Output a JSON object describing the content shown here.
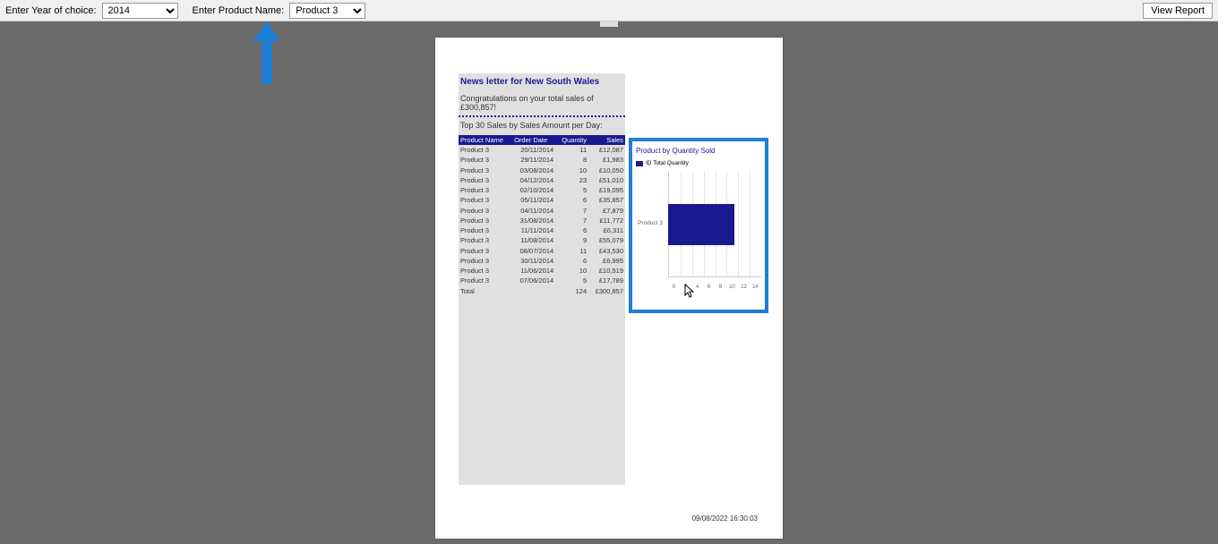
{
  "params": {
    "year_label": "Enter Year of choice:",
    "year_value": "2014",
    "product_label": "Enter Product Name:",
    "product_value": "Product 3",
    "view_report": "View Report"
  },
  "report": {
    "newsletter_title": "News letter for New South Wales",
    "congrats": "Congratulations on your total sales of £300,857!",
    "top_sales_title": "Top 30 Sales by Sales Amount per Day:",
    "headers": {
      "product": "Product Name",
      "date": "Order Date",
      "qty": "Quantity",
      "sales": "Sales"
    },
    "rows": [
      {
        "p": "Product 3",
        "d": "20/11/2014",
        "q": "11",
        "s": "£12,087"
      },
      {
        "p": "Product 3",
        "d": "29/11/2014",
        "q": "8",
        "s": "£1,983"
      },
      {
        "p": "Product 3",
        "d": "03/08/2014",
        "q": "10",
        "s": "£10,050"
      },
      {
        "p": "Product 3",
        "d": "04/12/2014",
        "q": "23",
        "s": "£51,010"
      },
      {
        "p": "Product 3",
        "d": "02/10/2014",
        "q": "5",
        "s": "£19,095"
      },
      {
        "p": "Product 3",
        "d": "05/11/2014",
        "q": "6",
        "s": "£35,857"
      },
      {
        "p": "Product 3",
        "d": "04/11/2014",
        "q": "7",
        "s": "£7,879"
      },
      {
        "p": "Product 3",
        "d": "31/08/2014",
        "q": "7",
        "s": "£11,772"
      },
      {
        "p": "Product 3",
        "d": "11/11/2014",
        "q": "6",
        "s": "£6,311"
      },
      {
        "p": "Product 3",
        "d": "11/08/2014",
        "q": "9",
        "s": "£55,079"
      },
      {
        "p": "Product 3",
        "d": "08/07/2014",
        "q": "11",
        "s": "£43,530"
      },
      {
        "p": "Product 3",
        "d": "30/11/2014",
        "q": "6",
        "s": "£6,995"
      },
      {
        "p": "Product 3",
        "d": "11/06/2014",
        "q": "10",
        "s": "£10,519"
      },
      {
        "p": "Product 3",
        "d": "07/06/2014",
        "q": "5",
        "s": "£17,789"
      }
    ],
    "total_label": "Total",
    "total_qty": "124",
    "total_sales": "£300,857",
    "timestamp": "09/08/2022 16:30:03"
  },
  "chart_data": {
    "type": "bar",
    "title": "Product by Quantity Sold",
    "legend": "ID Total Quantity",
    "categories": [
      "Product 3"
    ],
    "values": [
      10
    ],
    "x_ticks": [
      "0",
      "2",
      "4",
      "6",
      "8",
      "10",
      "12",
      "14"
    ],
    "xlim": [
      0,
      14
    ]
  }
}
